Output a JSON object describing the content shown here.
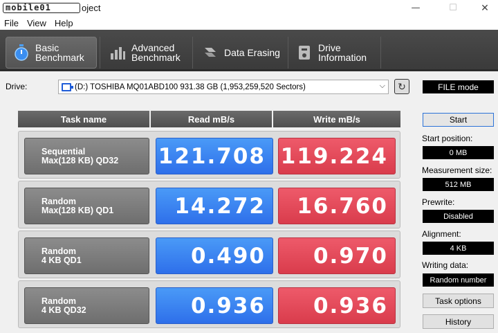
{
  "window": {
    "logo_text": "mobile01",
    "title_suffix": "oject",
    "min": "—",
    "max": "☐",
    "close": "✕"
  },
  "menu": [
    "File",
    "View",
    "Help"
  ],
  "toolbar": {
    "tabs": [
      {
        "line1": "Basic",
        "line2": "Benchmark",
        "icon": "stopwatch-icon",
        "active": true
      },
      {
        "line1": "Advanced",
        "line2": "Benchmark",
        "icon": "bar-chart-icon",
        "active": false
      },
      {
        "line1": "Data Erasing",
        "line2": "",
        "icon": "eraser-icon",
        "active": false
      },
      {
        "line1": "Drive",
        "line2": "Information",
        "icon": "drive-info-icon",
        "active": false
      }
    ]
  },
  "drive": {
    "label": "Drive:",
    "selected": "(D:) TOSHIBA MQ01ABD100  931.38 GB (1,953,259,520 Sectors)"
  },
  "mode": "FILE mode",
  "grid": {
    "headers": [
      "Task name",
      "Read mB/s",
      "Write mB/s"
    ],
    "rows": [
      {
        "task": "Sequential\nMax(128 KB) QD32",
        "read": "121.708",
        "write": "119.224"
      },
      {
        "task": "Random\nMax(128 KB) QD1",
        "read": "14.272",
        "write": "16.760"
      },
      {
        "task": "Random\n4 KB QD1",
        "read": "0.490",
        "write": "0.970"
      },
      {
        "task": "Random\n4 KB QD32",
        "read": "0.936",
        "write": "0.936"
      }
    ]
  },
  "panel": {
    "start": "Start",
    "start_position": {
      "label": "Start position:",
      "value": "0 MB"
    },
    "measurement_size": {
      "label": "Measurement size:",
      "value": "512 MB"
    },
    "prewrite": {
      "label": "Prewrite:",
      "value": "Disabled"
    },
    "alignment": {
      "label": "Alignment:",
      "value": "4 KB"
    },
    "writing_data": {
      "label": "Writing data:",
      "value": "Random number"
    },
    "task_options": "Task options",
    "history": "History"
  },
  "colors": {
    "read": "#3a82f2",
    "write": "#e44c5c",
    "accent": "#2b72d8"
  }
}
